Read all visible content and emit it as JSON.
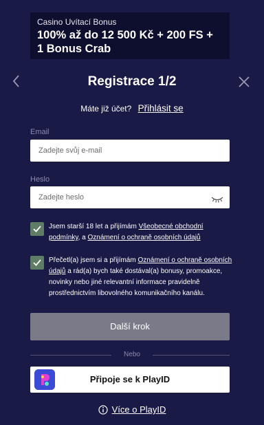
{
  "bonus": {
    "kicker": "Casino Uvítací Bonus",
    "title_line1": "100% až do 12 500 Kč + 200 FS +",
    "title_line2": "1 Bonus Crab"
  },
  "header": {
    "title": "Registrace 1/2",
    "back_icon": "chevron-left-icon",
    "close_icon": "close-icon"
  },
  "login": {
    "question": "Máte již účet?",
    "link": "Přihlásit se"
  },
  "form": {
    "email_label": "Email",
    "email_placeholder": "Zadejte svůj e-mail",
    "password_label": "Heslo",
    "password_placeholder": "Zadejte heslo",
    "password_toggle_icon": "eye-closed-icon"
  },
  "consents": {
    "age": {
      "checked": true,
      "text_before": "Jsem starší 18 let a přijímám ",
      "link1": "Všeobecné obchodní podmínky",
      "text_between": ", a ",
      "link2": "Oznámení o ochraně osobních údajů"
    },
    "marketing": {
      "checked": true,
      "text_before": "Přečetl(a) jsem si a přijímám ",
      "link": "Oznámení o ochraně osobních údajů",
      "text_after": " a rád(a) bych také dostával(a) bonusy, promoakce, novinky nebo jiné relevantní informace pravidelně prostřednictvím libovolného komunikačního kanálu."
    }
  },
  "actions": {
    "next_label": "Další krok",
    "divider_label": "Nebo",
    "playid_label": "Připoje se k PlayID",
    "more_label": "Více o PlayID",
    "info_icon": "info-icon"
  },
  "colors": {
    "background": "#1a1a47",
    "banner": "#0e0e2e",
    "checkbox": "#5e7c66",
    "button_disabled": "#7a7a88"
  }
}
